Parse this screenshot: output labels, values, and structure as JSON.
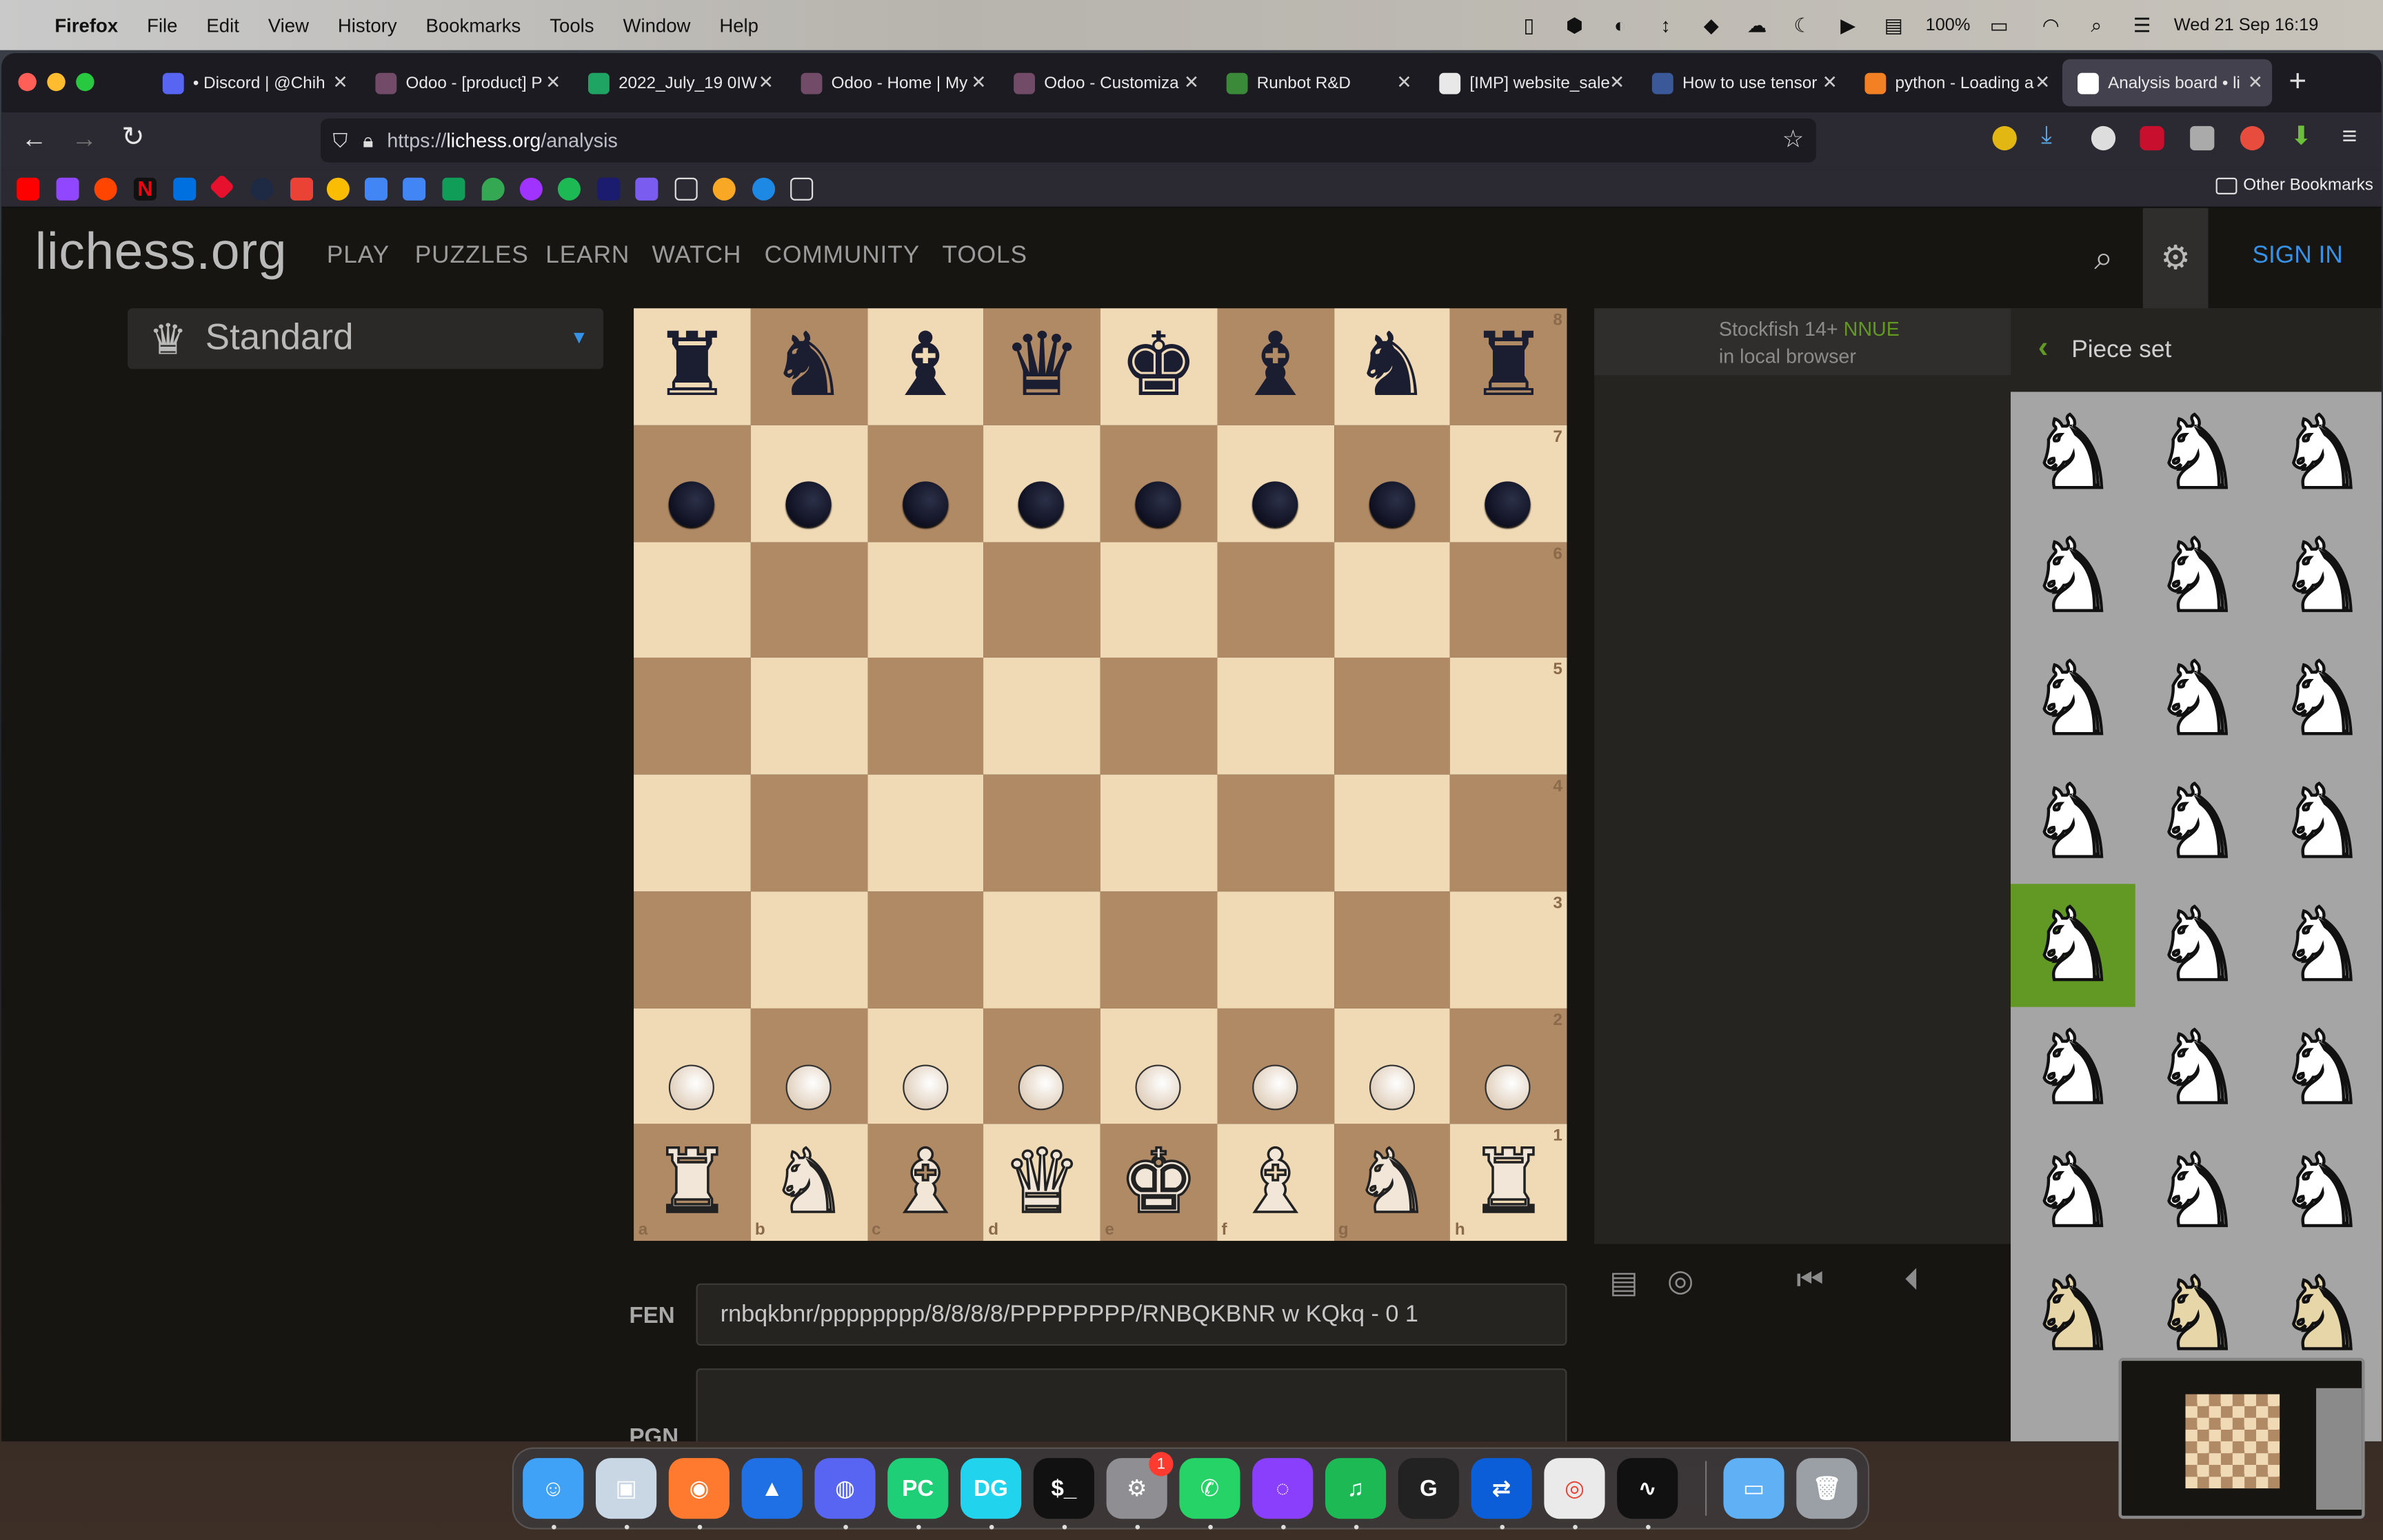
{
  "menubar": {
    "app": "Firefox",
    "menus": [
      "File",
      "Edit",
      "View",
      "History",
      "Bookmarks",
      "Tools",
      "Window",
      "Help"
    ],
    "battery": "100%",
    "datetime": "Wed 21 Sep  16:19"
  },
  "tabs": [
    {
      "title": "• Discord | @Chih",
      "color": "#5865f2"
    },
    {
      "title": "Odoo - [product] P",
      "color": "#714b67"
    },
    {
      "title": "2022_July_19 0IW",
      "color": "#1fa463"
    },
    {
      "title": "Odoo - Home | My",
      "color": "#714b67"
    },
    {
      "title": "Odoo - Customiza",
      "color": "#714b67"
    },
    {
      "title": "Runbot R&D",
      "color": "#3a8a3a"
    },
    {
      "title": "[IMP] website_sale",
      "color": "#e8e8e8"
    },
    {
      "title": "How to use tensor",
      "color": "#3b5998"
    },
    {
      "title": "python - Loading a",
      "color": "#f48024"
    },
    {
      "title": "Analysis board • li",
      "color": "#ffffff"
    }
  ],
  "url": {
    "prefix": "https://",
    "domain": "lichess.org",
    "path": "/analysis"
  },
  "bookmarks": {
    "other": "Other Bookmarks"
  },
  "site": {
    "logo": "lichess.org",
    "nav": [
      "PLAY",
      "PUZZLES",
      "LEARN",
      "WATCH",
      "COMMUNITY",
      "TOOLS"
    ],
    "sign_in": "SIGN IN",
    "variant": "Standard"
  },
  "board": {
    "ranks": [
      "8",
      "7",
      "6",
      "5",
      "4",
      "3",
      "2",
      "1"
    ],
    "files": [
      "a",
      "b",
      "c",
      "d",
      "e",
      "f",
      "g",
      "h"
    ],
    "back_rank_black": [
      "♜",
      "♞",
      "♝",
      "♛",
      "♚",
      "♝",
      "♞",
      "♜"
    ],
    "back_rank_white": [
      "♜",
      "♞",
      "♝",
      "♛",
      "♚",
      "♝",
      "♞",
      "♜"
    ]
  },
  "engine": {
    "name": "Stockfish 14+",
    "tag": "NNUE",
    "location": "in local browser"
  },
  "piece_set": {
    "title": "Piece set",
    "selected_index": 12,
    "count": 24
  },
  "fen": {
    "label": "FEN",
    "value": "rnbqkbnr/pppppppp/8/8/8/8/PPPPPPPP/RNBQKBNR w KQkq - 0 1"
  },
  "pgn": {
    "label": "PGN"
  },
  "dock": {
    "apps": [
      "Finder",
      "Preview",
      "Firefox",
      "Linear",
      "Discord",
      "PyCharm",
      "DataGrip",
      "Terminal",
      "System Preferences",
      "WhatsApp",
      "Messenger",
      "Spotify",
      "Logi",
      "Remote",
      "Chrome",
      "Activity Monitor",
      "Downloads",
      "Trash"
    ],
    "badge": "1"
  }
}
